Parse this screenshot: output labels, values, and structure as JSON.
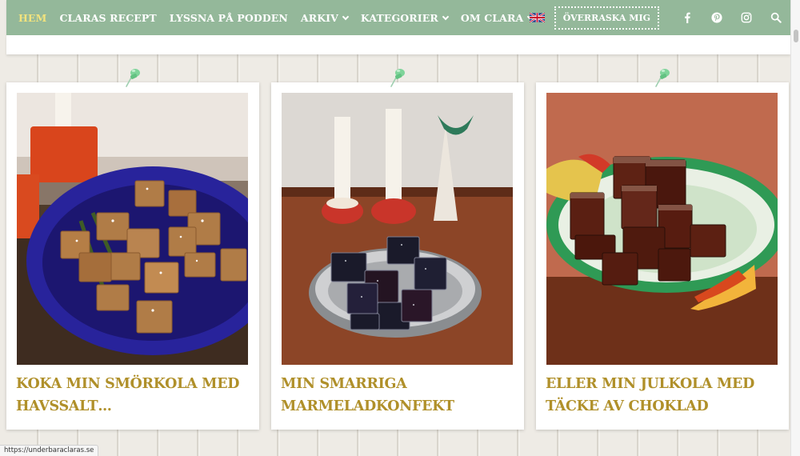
{
  "nav": {
    "items": [
      {
        "label": "Hem",
        "active": true,
        "dropdown": false
      },
      {
        "label": "Claras recept",
        "active": false,
        "dropdown": false
      },
      {
        "label": "Lyssna på podden",
        "active": false,
        "dropdown": false
      },
      {
        "label": "Arkiv",
        "active": false,
        "dropdown": true
      },
      {
        "label": "Kategorier",
        "active": false,
        "dropdown": true
      },
      {
        "label": "Om Clara",
        "active": false,
        "dropdown": true
      }
    ],
    "surprise_label": "Överraska mig",
    "language_flag": "uk-flag-icon",
    "social_icons": [
      "facebook-icon",
      "pinterest-icon",
      "instagram-icon",
      "search-icon"
    ]
  },
  "posts": [
    {
      "title": "Koka min smörkola med havssalt…",
      "image": "caramels-on-blue-plate"
    },
    {
      "title": "Min smarriga marmeladkonfekt",
      "image": "jelly-candies-on-silver-plate"
    },
    {
      "title": "Eller min julkola med täcke av choklad",
      "image": "chocolate-toffee-on-green-plate"
    }
  ],
  "status_bar": {
    "url": "https://underbaraclaras.se"
  },
  "colors": {
    "nav_bg": "#94b89a",
    "nav_active": "#f2e37d",
    "title": "#b0902a",
    "pin": "#7fd49a"
  }
}
